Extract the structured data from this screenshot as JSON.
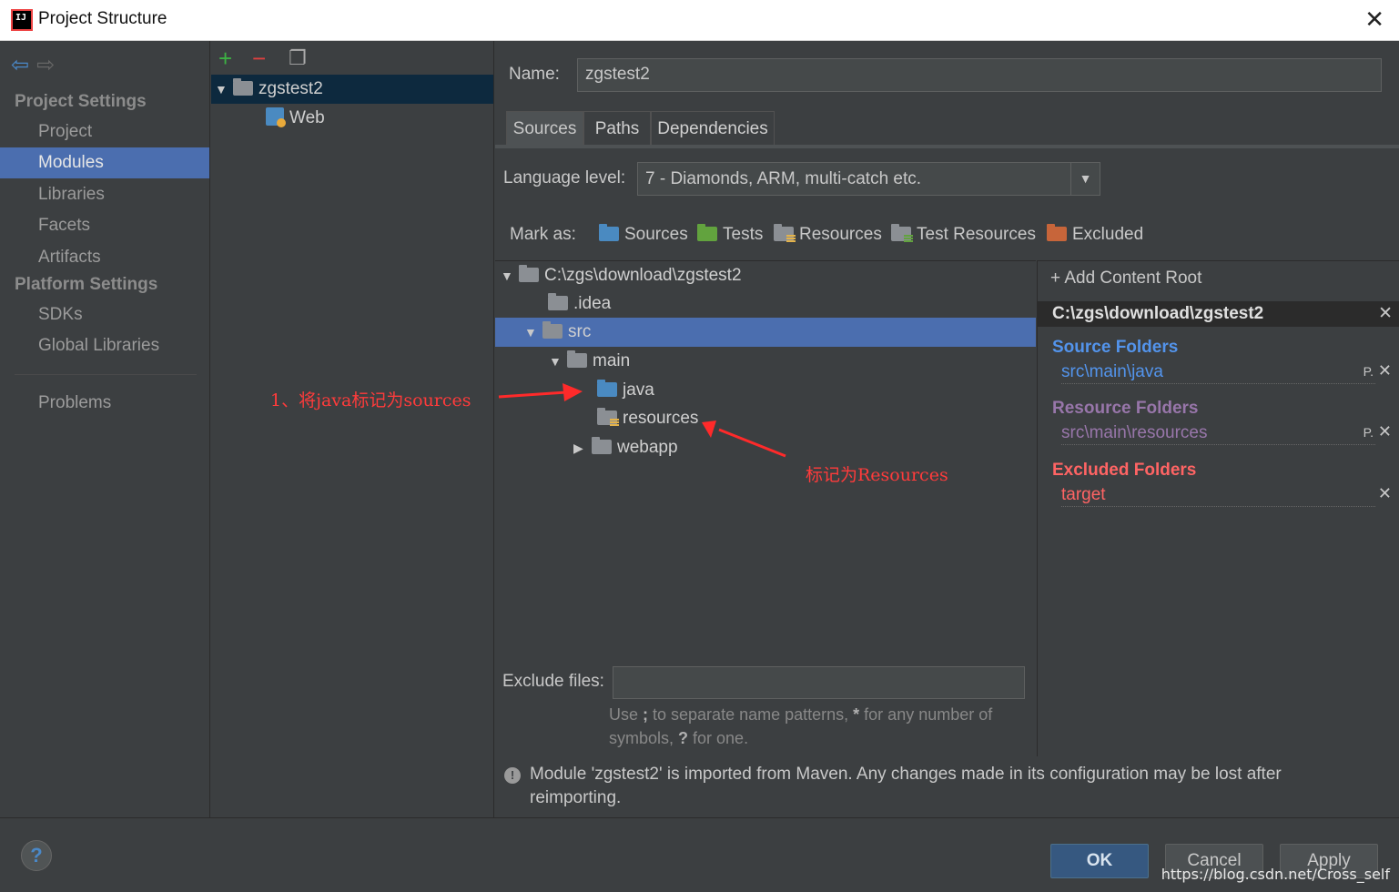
{
  "window": {
    "title": "Project Structure",
    "close_glyph": "✕"
  },
  "nav": {
    "project_settings_header": "Project Settings",
    "project_items": [
      {
        "label": "Project"
      },
      {
        "label": "Modules"
      },
      {
        "label": "Libraries"
      },
      {
        "label": "Facets"
      },
      {
        "label": "Artifacts"
      }
    ],
    "platform_settings_header": "Platform Settings",
    "platform_items": [
      {
        "label": "SDKs"
      },
      {
        "label": "Global Libraries"
      }
    ],
    "problems": "Problems"
  },
  "modules": {
    "tree": [
      {
        "label": "zgstest2",
        "icon": "module-folder-icon"
      },
      {
        "label": "Web",
        "icon": "web-facet-icon"
      }
    ]
  },
  "main": {
    "name_label": "Name:",
    "name_value": "zgstest2",
    "tabs": [
      {
        "label": "Sources"
      },
      {
        "label": "Paths"
      },
      {
        "label": "Dependencies"
      }
    ],
    "language_level_label": "Language level:",
    "language_level_value": "7 - Diamonds, ARM, multi-catch etc.",
    "mark_as_label": "Mark as:",
    "mark_as": [
      {
        "label": "Sources",
        "icon": "sources-folder-icon"
      },
      {
        "label": "Tests",
        "icon": "tests-folder-icon"
      },
      {
        "label": "Resources",
        "icon": "resources-folder-icon"
      },
      {
        "label": "Test Resources",
        "icon": "test-resources-folder-icon"
      },
      {
        "label": "Excluded",
        "icon": "excluded-folder-icon"
      }
    ],
    "tree": [
      {
        "label": "C:\\zgs\\download\\zgstest2"
      },
      {
        "label": ".idea"
      },
      {
        "label": "src"
      },
      {
        "label": "main"
      },
      {
        "label": "java"
      },
      {
        "label": "resources"
      },
      {
        "label": "webapp"
      }
    ],
    "content_root_panel": {
      "add_label": "Add Content Root",
      "root_path": "C:\\zgs\\download\\zgstest2",
      "source_folders_header": "Source Folders",
      "source_folder": "src\\main\\java",
      "resource_folders_header": "Resource Folders",
      "resource_folder": "src\\main\\resources",
      "excluded_folders_header": "Excluded Folders",
      "excluded_folder": "target",
      "colors": {
        "source": "#5394ec",
        "resource": "#9876aa",
        "excluded": "#ff6464"
      }
    },
    "exclude_files_label": "Exclude files:",
    "exclude_files_value": "",
    "exclude_hint_1": "Use ",
    "exclude_hint_sep": ";",
    "exclude_hint_2": " to separate name patterns, ",
    "exclude_hint_star": "*",
    "exclude_hint_3": " for any number of symbols, ",
    "exclude_hint_q": "?",
    "exclude_hint_4": " for one.",
    "notice": "Module 'zgstest2' is imported from Maven. Any changes made in its configuration may be lost after reimporting."
  },
  "buttons": {
    "ok": "OK",
    "cancel": "Cancel",
    "apply": "Apply",
    "help": "?"
  },
  "annotations": {
    "java_note": "1、将java标记为sources",
    "resources_note": "标记为Resources"
  },
  "watermark": "https://blog.csdn.net/Cross_self"
}
